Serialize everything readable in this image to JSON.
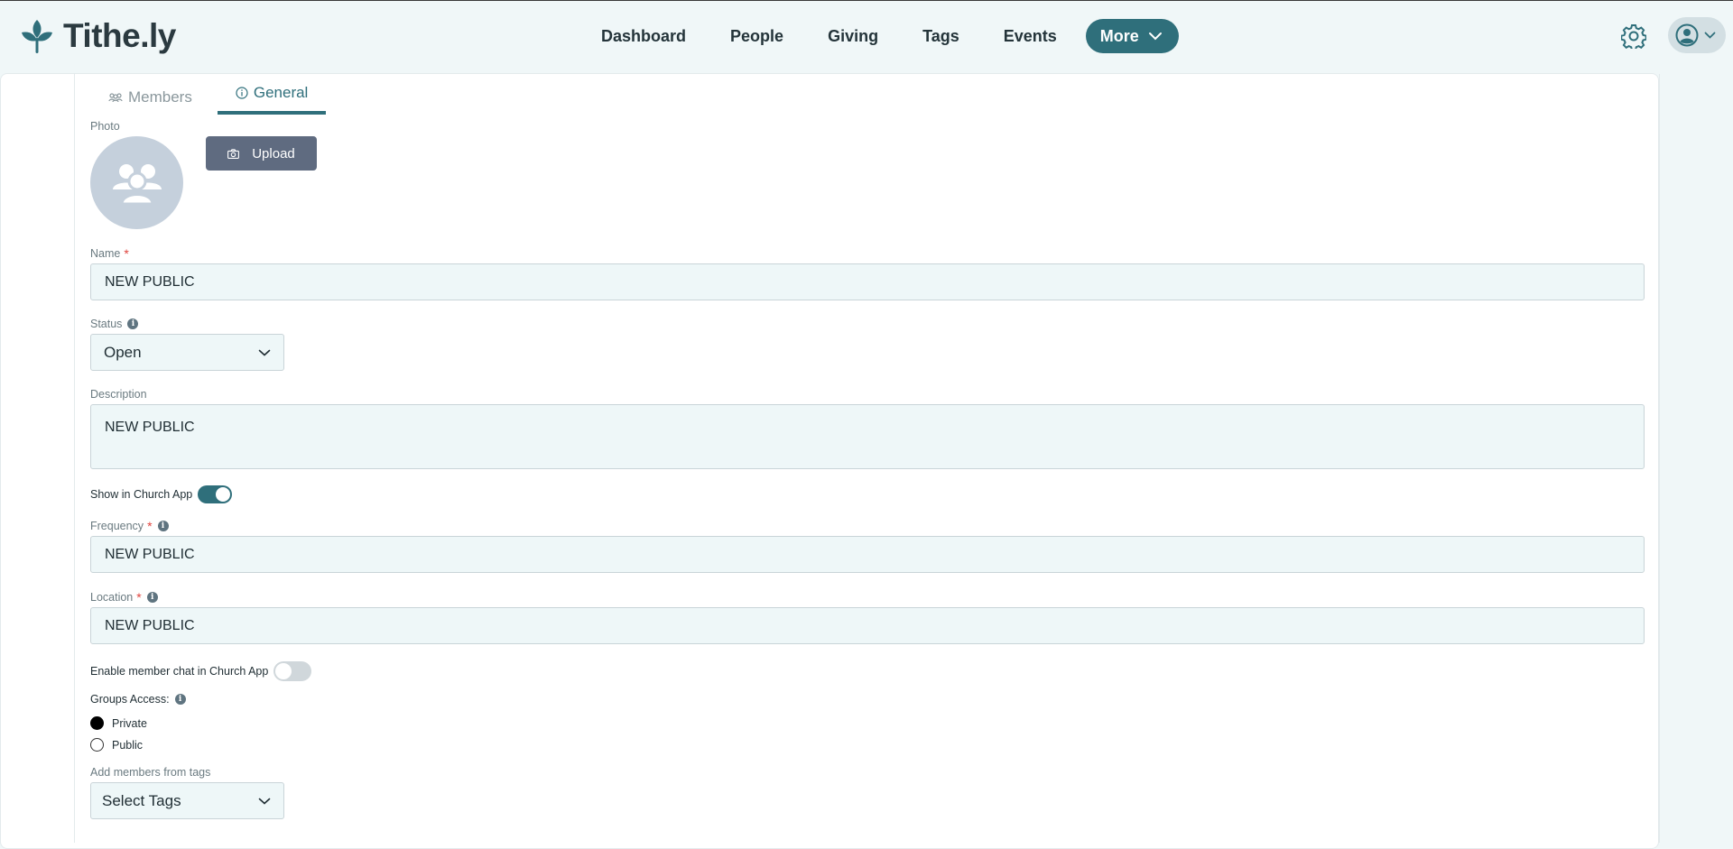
{
  "header": {
    "logo_text": "Tithe.ly",
    "nav": [
      "Dashboard",
      "People",
      "Giving",
      "Tags",
      "Events"
    ],
    "more_label": "More"
  },
  "tabs": [
    {
      "label": "Members",
      "icon": "members-icon",
      "active": false
    },
    {
      "label": "General",
      "icon": "info-circle-icon",
      "active": true
    }
  ],
  "form": {
    "photo_label": "Photo",
    "upload_label": "Upload",
    "name_label": "Name",
    "name_value": "NEW PUBLIC",
    "status_label": "Status",
    "status_value": "Open",
    "description_label": "Description",
    "description_value": "NEW PUBLIC",
    "show_in_app_label": "Show in Church App",
    "show_in_app": true,
    "frequency_label": "Frequency",
    "frequency_value": "NEW PUBLIC",
    "location_label": "Location",
    "location_value": "NEW PUBLIC",
    "member_chat_label": "Enable member chat in Church App",
    "member_chat": false,
    "groups_access_label": "Groups Access:",
    "access_options": [
      "Private",
      "Public"
    ],
    "access_selected": "Private",
    "add_members_label": "Add members from tags",
    "tags_placeholder": "Select Tags"
  },
  "colors": {
    "accent": "#2f6f7b",
    "upload_button": "#5f6b80",
    "background": "#f0f7f8"
  }
}
